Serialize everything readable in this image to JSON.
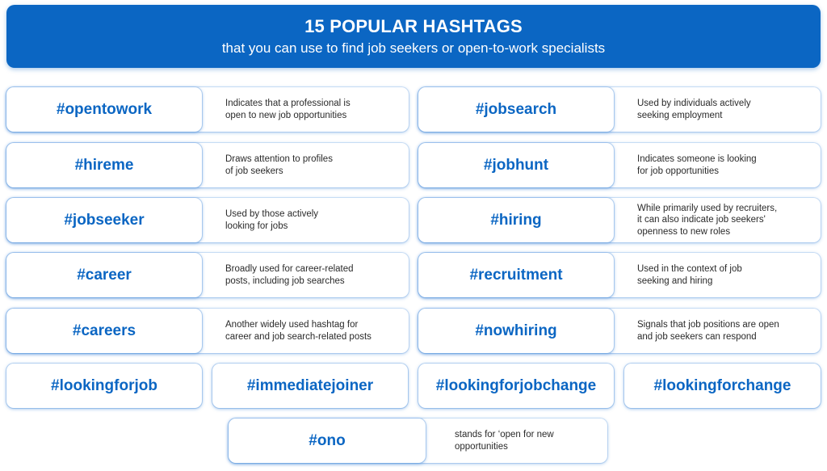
{
  "header": {
    "title": "15 POPULAR HASHTAGS",
    "subtitle": "that you can use to find job seekers or open-to-work specialists"
  },
  "colors": {
    "brand_blue": "#0b66c3",
    "text_dark": "#2a2a2a",
    "background": "#ffffff"
  },
  "left_column": [
    {
      "tag": "#opentowork",
      "description": "Indicates that a professional is\nopen to new job opportunities"
    },
    {
      "tag": "#hireme",
      "description": "Draws attention to profiles\nof job seekers"
    },
    {
      "tag": "#jobseeker",
      "description": "Used by those actively\nlooking for jobs"
    },
    {
      "tag": "#career",
      "description": "Broadly used for career-related\nposts, including job searches"
    },
    {
      "tag": "#careers",
      "description": "Another widely used hashtag for\ncareer and job search-related posts"
    }
  ],
  "right_column": [
    {
      "tag": "#jobsearch",
      "description": "Used by individuals actively\nseeking employment"
    },
    {
      "tag": "#jobhunt",
      "description": "Indicates someone is looking\nfor job opportunities"
    },
    {
      "tag": "#hiring",
      "description": "While primarily used by recruiters,\nit can also indicate job seekers'\nopenness to new roles"
    },
    {
      "tag": "#recruitment",
      "description": "Used in the context of job\nseeking and hiring"
    },
    {
      "tag": "#nowhiring",
      "description": "Signals that job positions are open\nand job seekers can respond"
    }
  ],
  "standalone_tags": [
    "#lookingforjob",
    "#immediatejoiner",
    "#lookingforjobchange",
    "#lookingforchange"
  ],
  "final": {
    "tag": "#ono",
    "description": "stands for ‘open for new\nopportunities"
  }
}
